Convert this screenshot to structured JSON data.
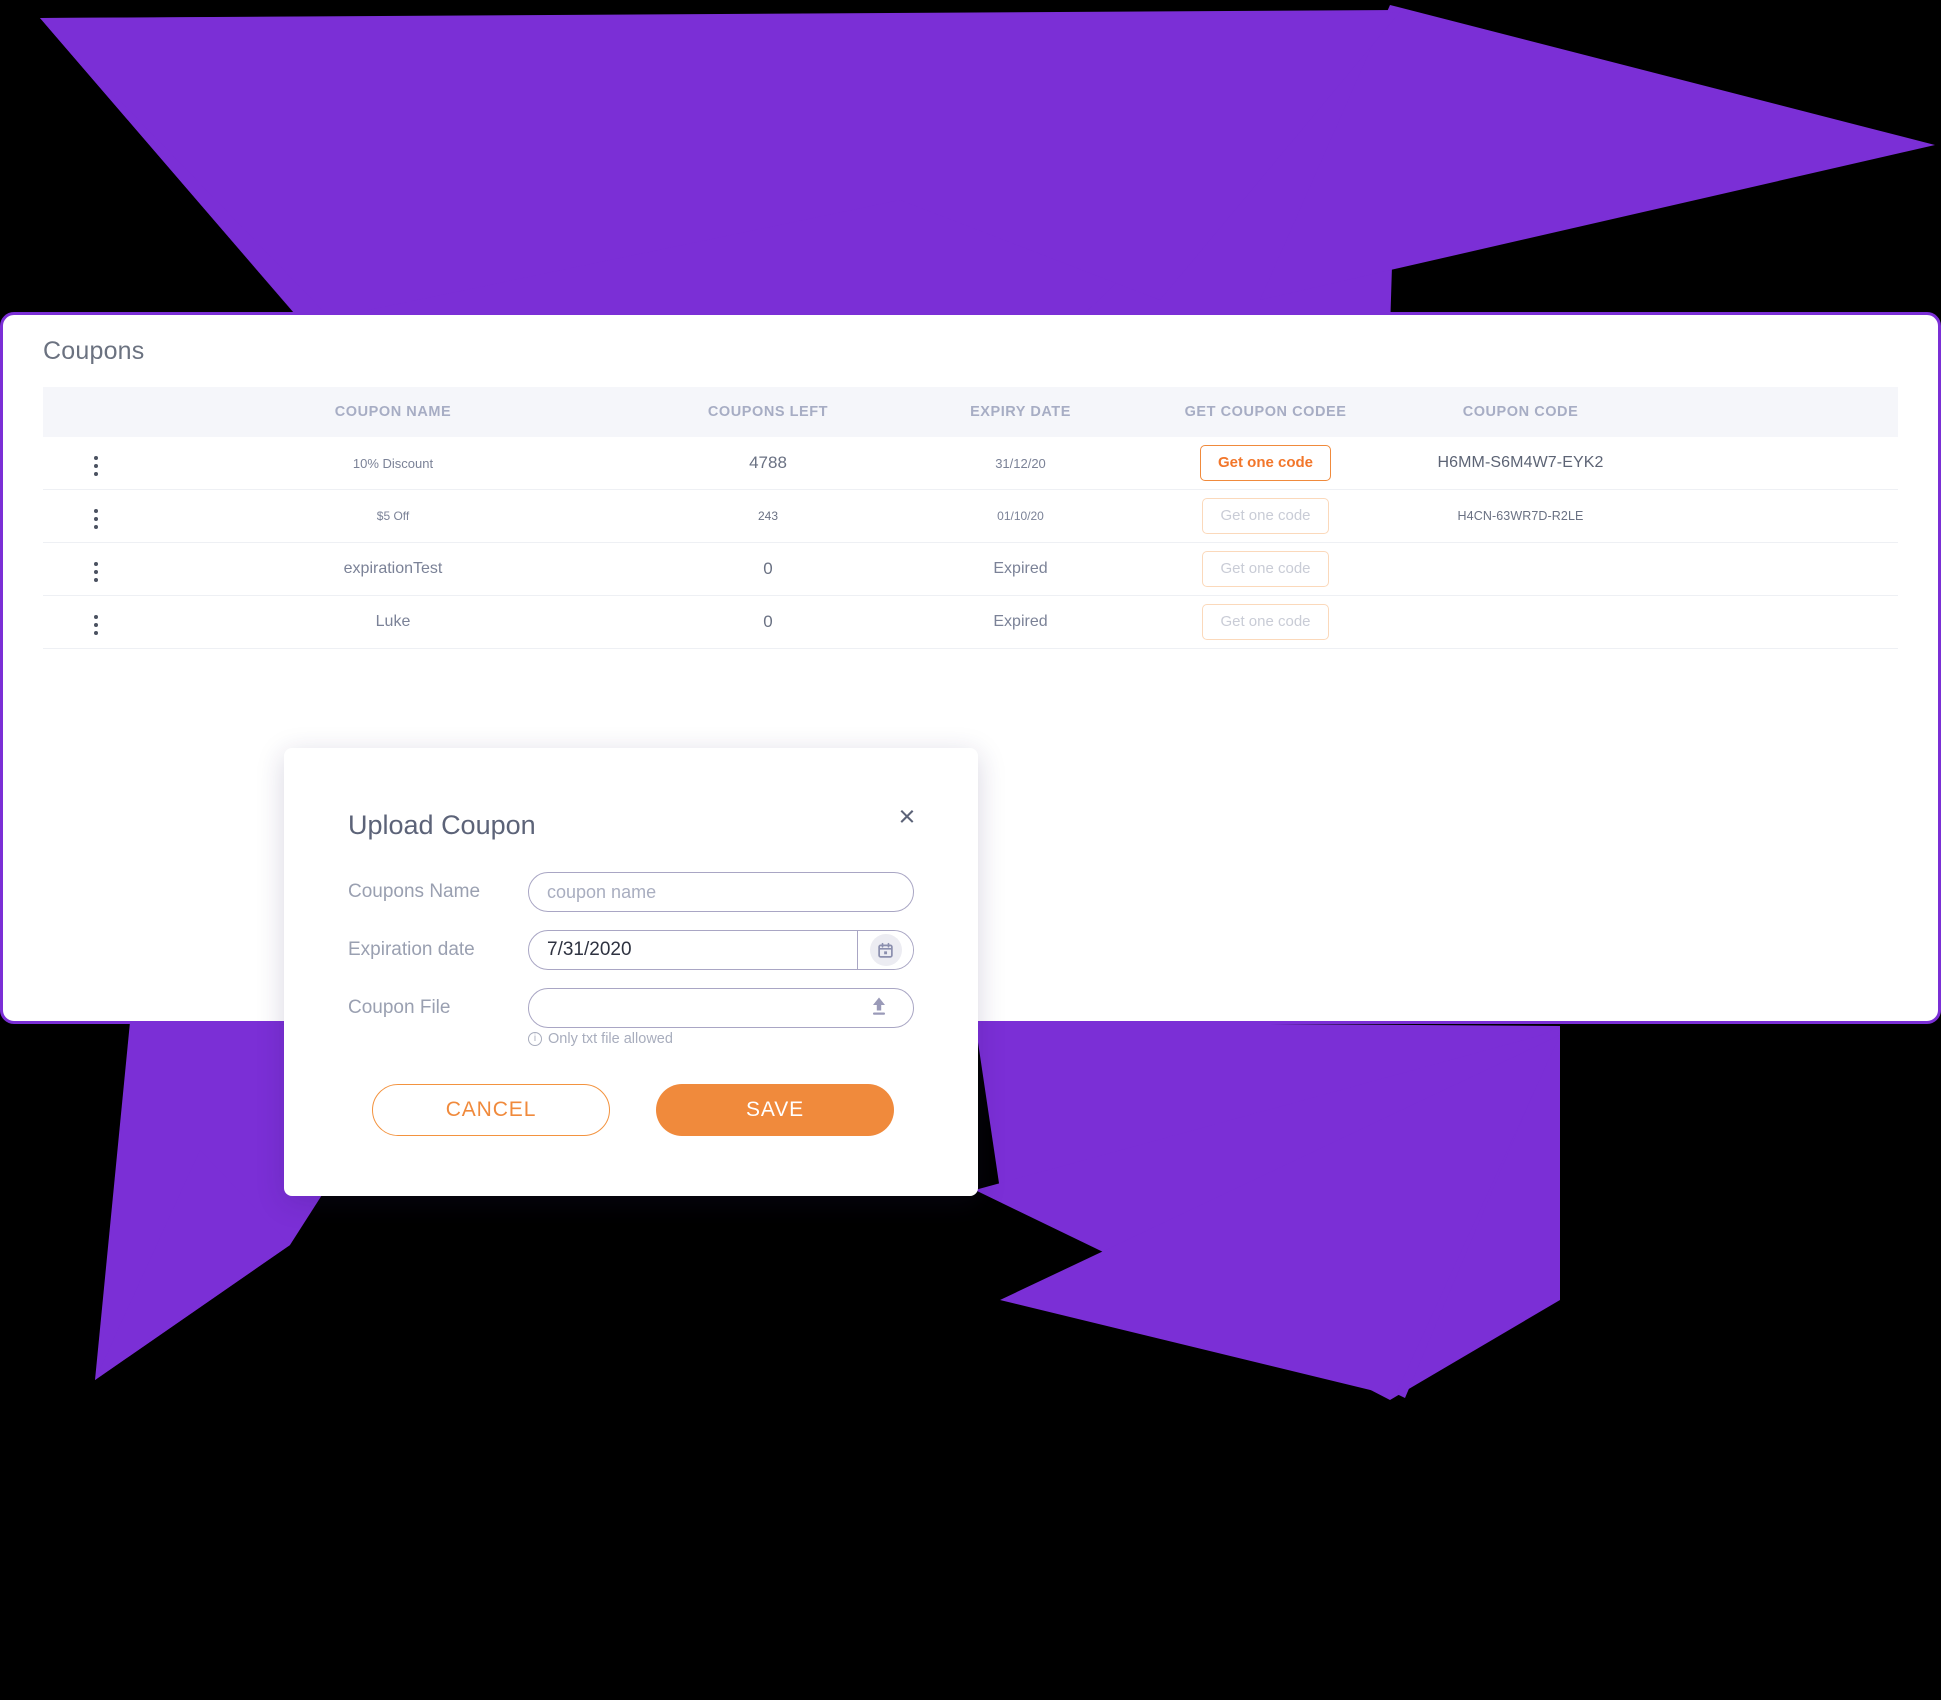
{
  "theme": {
    "background": "#000000",
    "accent_purple": "#7b2fd6",
    "accent_orange": "#f08a3c",
    "panel_bg": "#ffffff",
    "table_header_bg": "#f5f6fa",
    "muted_text": "#a7adc4"
  },
  "panel": {
    "title": "Coupons"
  },
  "table": {
    "columns": [
      {
        "key": "menu",
        "label": ""
      },
      {
        "key": "name",
        "label": "COUPON NAME"
      },
      {
        "key": "left",
        "label": "COUPONS LEFT"
      },
      {
        "key": "expiry",
        "label": "EXPIRY DATE"
      },
      {
        "key": "get",
        "label": "GET COUPON CODEE"
      },
      {
        "key": "code",
        "label": "COUPON CODE"
      }
    ],
    "get_code_label": "Get one code",
    "rows": [
      {
        "name": "10% Discount",
        "coupons_left": "4788",
        "expiry": "31/12/20",
        "get_label": "Get one code",
        "get_enabled": true,
        "code": "H6MM-S6M4W7-EYK2"
      },
      {
        "name": "$5 Off",
        "coupons_left": "243",
        "expiry": "01/10/20",
        "get_label": "Get one code",
        "get_enabled": false,
        "code": "H4CN-63WR7D-R2LE"
      },
      {
        "name": "expirationTest",
        "coupons_left": "0",
        "expiry": "Expired",
        "get_label": "Get one code",
        "get_enabled": false,
        "code": ""
      },
      {
        "name": "Luke",
        "coupons_left": "0",
        "expiry": "Expired",
        "get_label": "Get one code",
        "get_enabled": false,
        "code": ""
      }
    ]
  },
  "modal": {
    "title": "Upload Coupon",
    "close_label": "×",
    "fields": {
      "coupon_name": {
        "label": "Coupons Name",
        "placeholder": "coupon name",
        "value": ""
      },
      "expiration_date": {
        "label": "Expiration date",
        "value": "7/31/2020",
        "calendar_icon": "calendar-icon"
      },
      "coupon_file": {
        "label": "Coupon File",
        "value": "",
        "upload_icon": "upload-icon",
        "hint": "Only txt file allowed"
      }
    },
    "buttons": {
      "cancel": "CANCEL",
      "save": "SAVE"
    }
  }
}
